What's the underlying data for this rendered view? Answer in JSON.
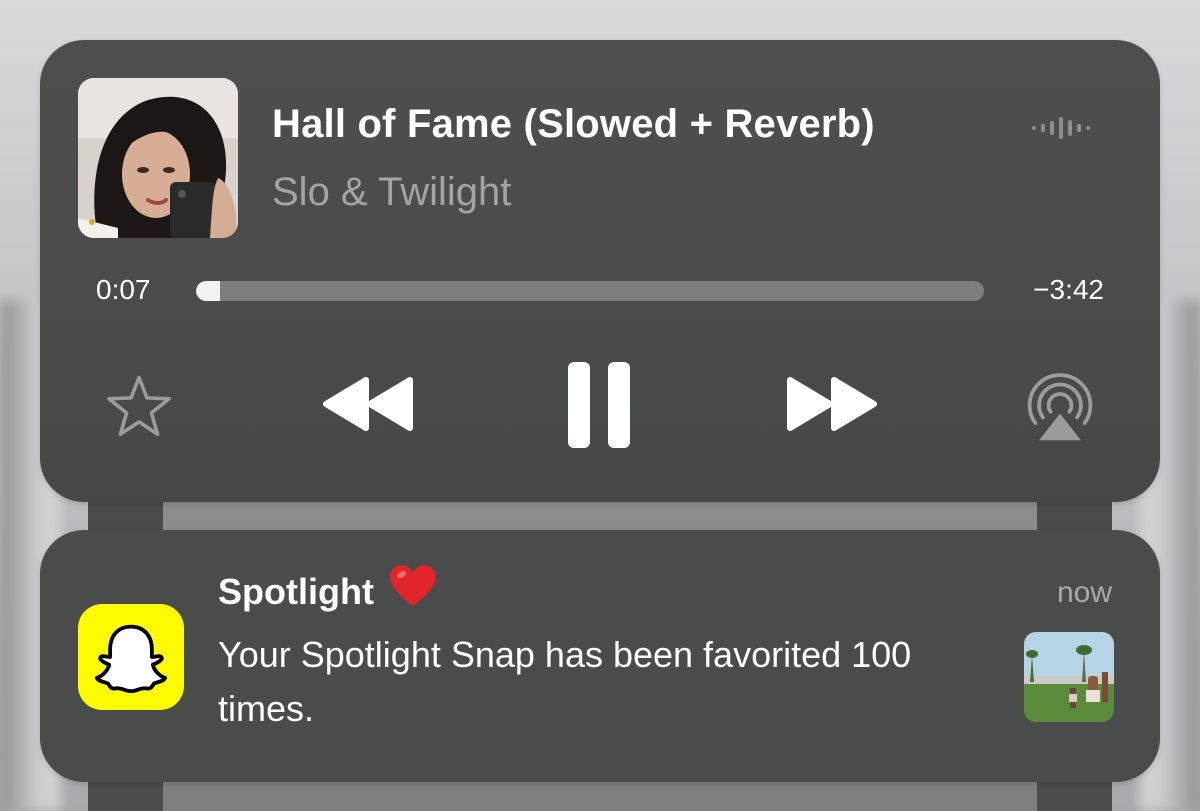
{
  "now_playing": {
    "title": "Hall of Fame (Slowed + Reverb)",
    "artist": "Slo & Twilight",
    "elapsed": "0:07",
    "remaining": "−3:42",
    "progress_fraction": 0.031,
    "icons": {
      "artwork": "album-artwork",
      "waveform": "audio-waveform-icon",
      "favorite": "star-outline-icon",
      "rewind": "rewind-icon",
      "pause": "pause-icon",
      "forward": "fast-forward-icon",
      "airplay": "airplay-audio-icon"
    }
  },
  "notification": {
    "app": "Snapchat",
    "title": "Spotlight",
    "emoji": "❤️",
    "time": "now",
    "body": "Your Spotlight Snap has been favorited 100 times.",
    "icons": {
      "app_icon": "snapchat-ghost-icon",
      "thumbnail": "snap-thumbnail"
    }
  },
  "colors": {
    "card_background": "#4a4b4b",
    "primary_text": "#ffffff",
    "secondary_text": "#a4a4a4",
    "progress_track": "#7c7d7d",
    "progress_fill": "#f2f2f2",
    "snapchat_yellow": "#fffc00",
    "heart_red": "#e0252b"
  }
}
